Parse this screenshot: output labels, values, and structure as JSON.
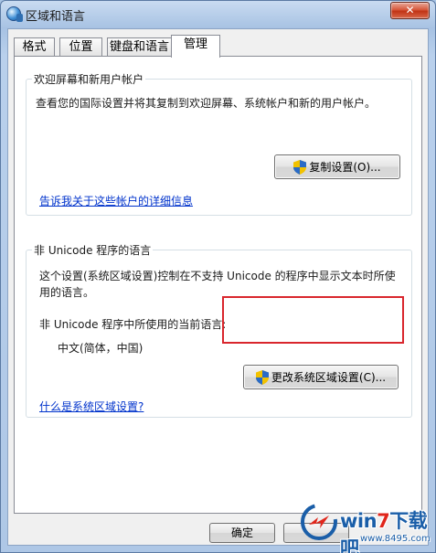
{
  "window": {
    "title": "区域和语言",
    "close_glyph": "✕"
  },
  "tabs": [
    {
      "label": "格式"
    },
    {
      "label": "位置"
    },
    {
      "label": "键盘和语言"
    },
    {
      "label": "管理",
      "active": true
    }
  ],
  "welcome_group": {
    "title": "欢迎屏幕和新用户帐户",
    "description": "查看您的国际设置并将其复制到欢迎屏幕、系统帐户和新的用户帐户。",
    "copy_button": "复制设置(O)...",
    "link": "告诉我关于这些帐户的详细信息"
  },
  "non_unicode_group": {
    "title": "非 Unicode 程序的语言",
    "description_line1": "这个设置(系统区域设置)控制在不支持 Unicode 的程序中显示文本时所使",
    "description_line2": "用的语言。",
    "current_label": "非 Unicode 程序中所使用的当前语言:",
    "current_value": "中文(简体，中国)",
    "change_button": "更改系统区域设置(C)...",
    "link": "什么是系统区域设置?"
  },
  "footer": {
    "ok_button": "确定"
  },
  "watermark": {
    "brand_prefix": "win",
    "brand_seven": "7",
    "brand_suffix": "下载吧",
    "url": "www.8495.com"
  },
  "colors": {
    "highlight": "#d9262d",
    "link": "#0033cc",
    "close": "#c13315"
  }
}
